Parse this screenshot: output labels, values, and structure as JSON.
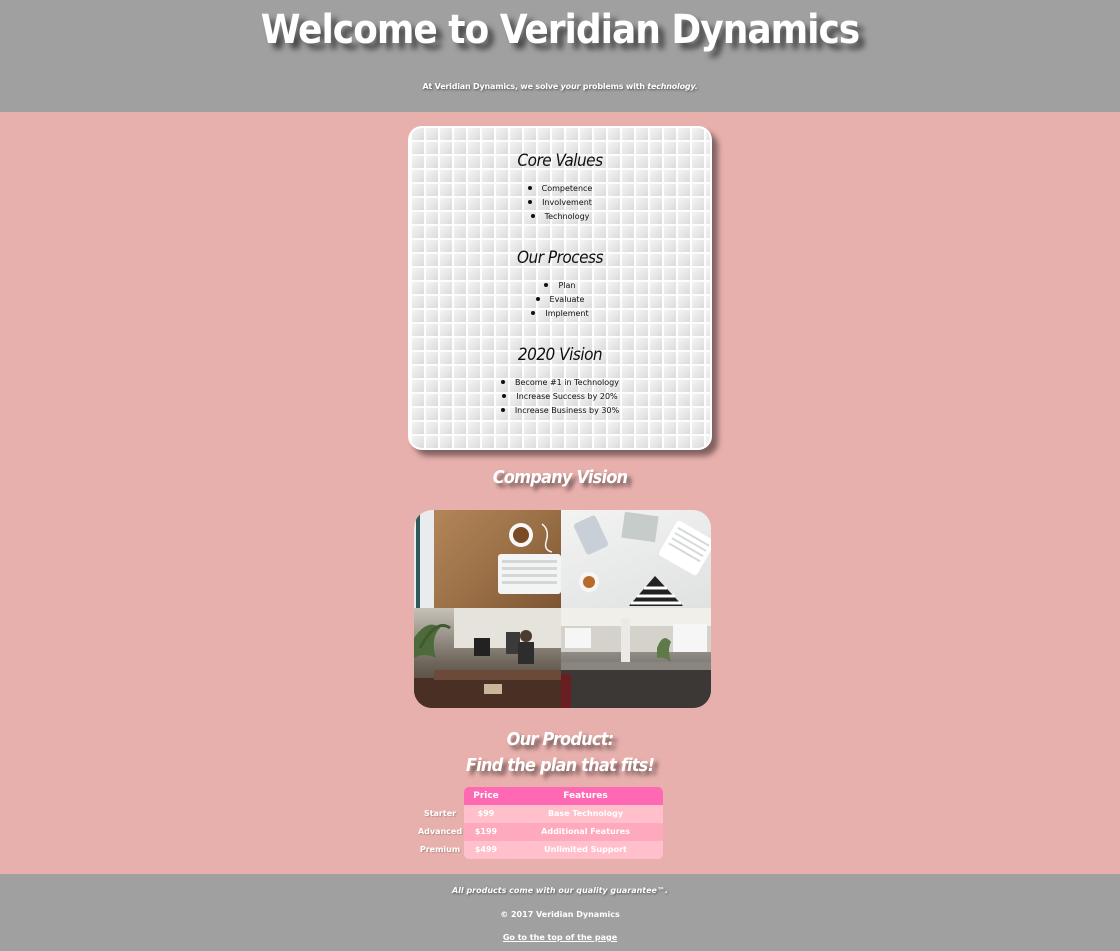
{
  "header": {
    "title": "Welcome to Veridian Dynamics",
    "tagline_before": "At Veridian Dynamics, we solve ",
    "tagline_emph_1": "your",
    "tagline_middle": " problems with ",
    "tagline_emph_2": "technology."
  },
  "info_card": {
    "sections": [
      {
        "heading": "Core Values",
        "items": [
          "Competence",
          "Involvement",
          "Technology"
        ]
      },
      {
        "heading": "Our Process",
        "items": [
          "Plan",
          "Evaluate",
          "Implement"
        ]
      },
      {
        "heading": "2020 Vision",
        "items": [
          "Become #1 in Technology",
          "Increase Success by 20%",
          "Increase Business by 30%"
        ]
      }
    ]
  },
  "gallery": {
    "title": "Company Vision",
    "photos": [
      "desk-keyboard-coffee-photo",
      "white-desk-flatlay-photo",
      "office-workspace-photo",
      "open-office-photo"
    ]
  },
  "product": {
    "title_line_1": "Our Product:",
    "title_line_2": "Find the plan that fits!",
    "table": {
      "headers": [
        "Price",
        "Features"
      ],
      "rows": [
        {
          "plan": "Starter",
          "price": "$99",
          "features": "Base Technology"
        },
        {
          "plan": "Advanced",
          "price": "$199",
          "features": "Additional Features"
        },
        {
          "plan": "Premium",
          "price": "$499",
          "features": "Unlimited Support"
        }
      ]
    }
  },
  "footer": {
    "guarantee": "All products come with our quality guarantee™.",
    "copyright": "© 2017 Veridian Dynamics",
    "top_link": "Go to the top of the page"
  },
  "colors": {
    "page_background": "#e8b0ad",
    "header_footer": "#a0a0a0",
    "table_header": "#ff69b4",
    "table_row_light": "#ffc0cb",
    "table_row_dark": "#ffa9bd"
  }
}
